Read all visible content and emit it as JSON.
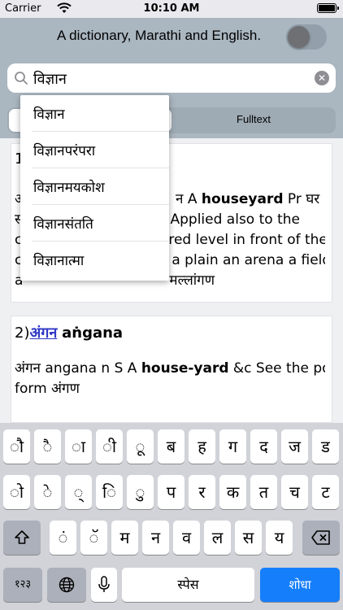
{
  "status": {
    "carrier": "Carrier",
    "time": "10:10 AM"
  },
  "header": {
    "title": "A dictionary, Marathi and English."
  },
  "search": {
    "value": "विज्ञान"
  },
  "segments": {
    "fulltext": "Fulltext"
  },
  "suggestions": [
    "विज्ञान",
    "विज्ञानपरंपरा",
    "विज्ञानमयकोश",
    "विज्ञानसंतति",
    "विज्ञानात्मा"
  ],
  "results": [
    {
      "num": "1",
      "lines": [
        {
          "pre": "अ",
          "mid": "न A ",
          "bold": "houseyard",
          "post": " Pr घर"
        },
        {
          "pre": "स",
          "mid": "Applied also to the",
          "bold": "",
          "post": ""
        },
        {
          "pre": "c",
          "mid": "red level in front of the",
          "bold": "",
          "post": ""
        },
        {
          "pre": "c",
          "mid": "a plain an arena a field",
          "bold": "",
          "post": ""
        },
        {
          "pre": "a",
          "mid": "मल्लांगण",
          "bold": "",
          "post": ""
        }
      ]
    },
    {
      "num": "2)",
      "link": "अंगन",
      "roman": "aṅgana",
      "line1_pre": "अंगन angana n S A ",
      "line1_bold": "house-yard",
      "line1_post": " &c See the pop",
      "line2": "form अंगण"
    }
  ],
  "keyboard": {
    "row1": [
      "ौ",
      "ै",
      "ा",
      "ी",
      "ू",
      "ब",
      "ह",
      "ग",
      "द",
      "ज",
      "ड"
    ],
    "row2": [
      "ो",
      "े",
      "्",
      "ि",
      "ु",
      "प",
      "र",
      "क",
      "त",
      "च",
      "ट"
    ],
    "row3": [
      "ं",
      "ॅ",
      "म",
      "न",
      "व",
      "ल",
      "स",
      "य"
    ],
    "numbers": "१२३",
    "space": "स्पेस",
    "go": "शोधा"
  }
}
